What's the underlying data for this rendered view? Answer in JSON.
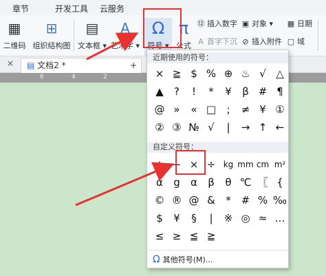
{
  "menu_tabs": [
    "章节",
    "开发工具",
    "云服务"
  ],
  "ribbon": {
    "qr": "二维码",
    "org": "组织结构图",
    "textbox": "文本框",
    "arttext": "艺术字",
    "symbol": "符号",
    "formula": "公式",
    "insert_number": "插入数字",
    "object": "对象",
    "date": "日期",
    "drop_cap": "首字下沉",
    "insert_attachment": "插入附件",
    "field": "域"
  },
  "document_tab": {
    "title": "文档2 *",
    "close": "×",
    "add": "+"
  },
  "ruler_marks": [
    "6",
    "4",
    "2"
  ],
  "dropdown": {
    "recent_title": "近期使用的符号：",
    "recent": [
      [
        "×",
        "≧",
        "$",
        "%",
        "⊕",
        "♨",
        "√",
        "△"
      ],
      [
        "▲",
        "?",
        "!",
        "*",
        "¥",
        "β",
        "#",
        "¶"
      ],
      [
        "@",
        "»",
        "«",
        "□",
        ";",
        "≠",
        "¥",
        "①"
      ],
      [
        "②",
        "③",
        "№",
        "√",
        "|",
        "→",
        "↑",
        "←"
      ]
    ],
    "custom_title": "自定义符号：",
    "custom": [
      [
        "+",
        "−",
        "×",
        "÷",
        "kg",
        "mm",
        "cm",
        "m²"
      ],
      [
        "α",
        "g",
        "α",
        "β",
        "θ",
        "℃",
        "〖",
        "{"
      ],
      [
        "©",
        "®",
        "@",
        "&",
        "*",
        "#",
        "%",
        "‰"
      ],
      [
        "$",
        "¥",
        "§",
        "|",
        "※",
        "◎",
        "≈",
        "…"
      ],
      [
        "≤",
        "≥",
        "≦",
        "≧"
      ]
    ],
    "more": "其他符号(M)...",
    "more_icon": "omega-icon"
  },
  "colors": {
    "highlight": "#e8322f",
    "page": "#cce6cc",
    "arrow": "#e8322f"
  }
}
